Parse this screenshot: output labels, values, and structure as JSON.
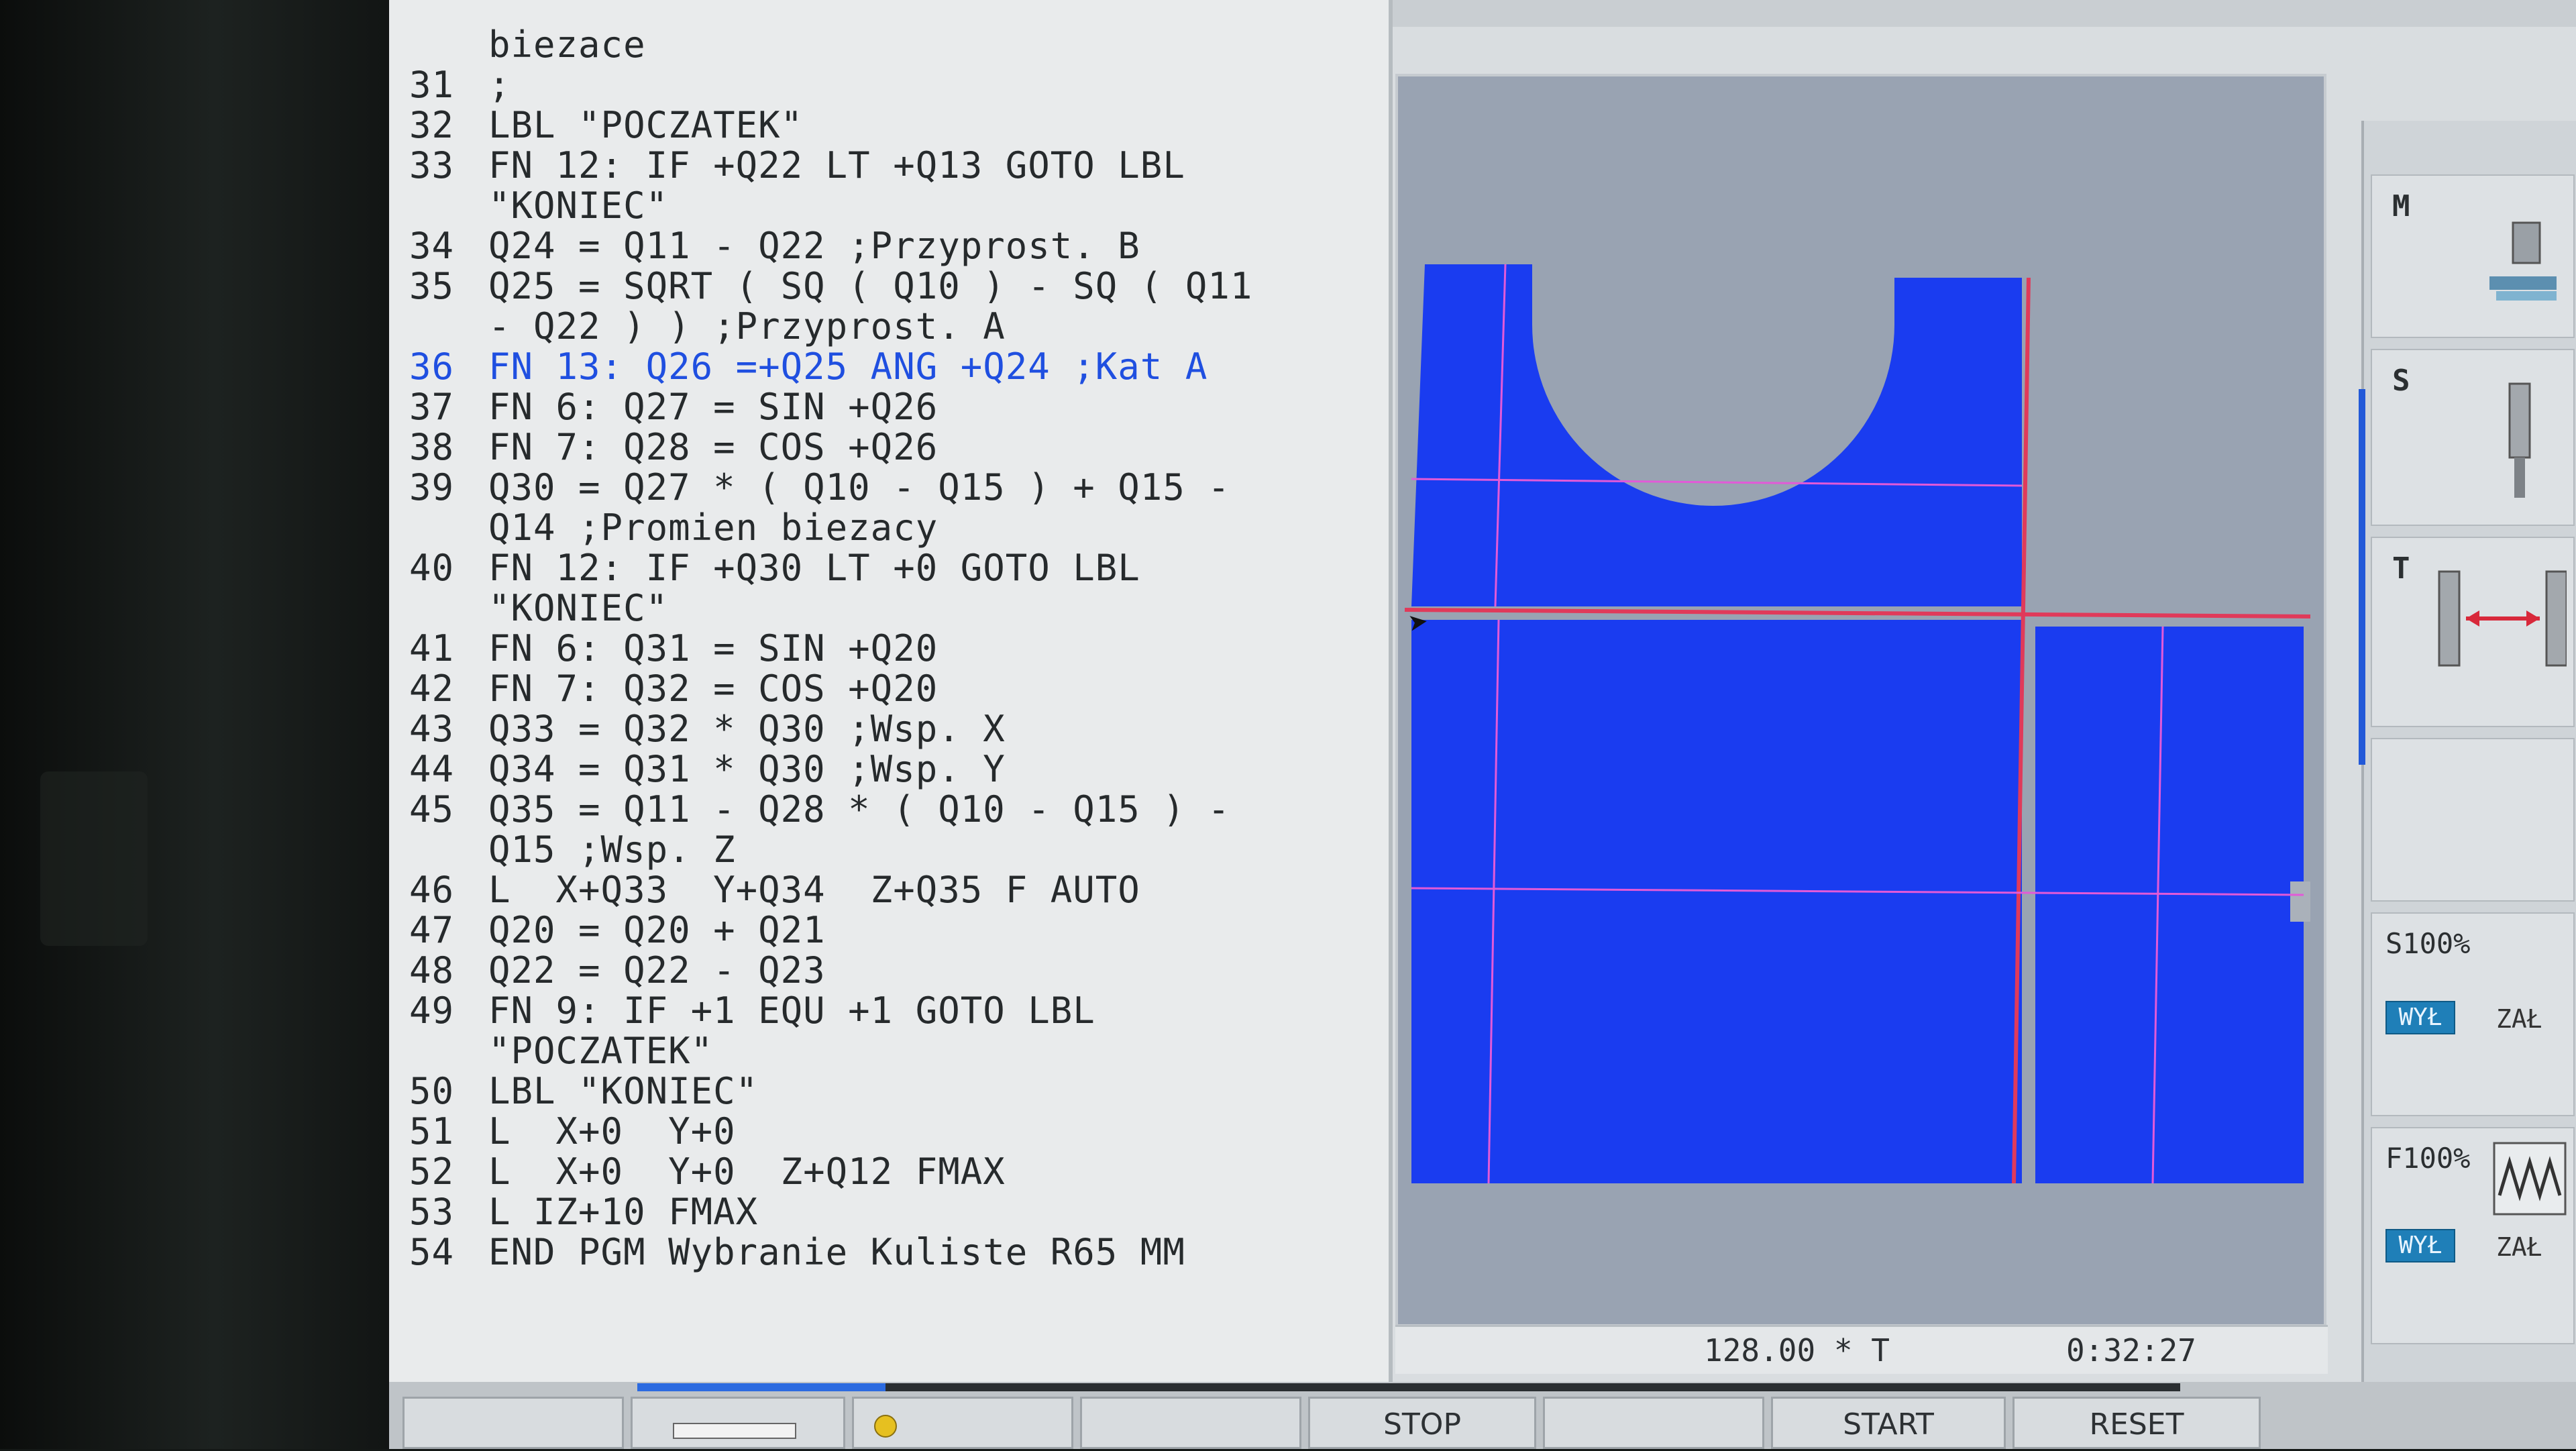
{
  "program": {
    "lines": [
      {
        "num": "",
        "text": "biezace"
      },
      {
        "num": "31",
        "text": ";"
      },
      {
        "num": "32",
        "text": "LBL \"POCZATEK\""
      },
      {
        "num": "33",
        "text": "FN 12: IF +Q22 LT +Q13 GOTO LBL"
      },
      {
        "num": "",
        "text": "\"KONIEC\""
      },
      {
        "num": "34",
        "text": "Q24 = Q11 - Q22 ;Przyprost. B"
      },
      {
        "num": "35",
        "text": "Q25 = SQRT ( SQ ( Q10 ) - SQ ( Q11"
      },
      {
        "num": "",
        "text": "- Q22 ) ) ;Przyprost. A"
      },
      {
        "num": "36",
        "text": "FN 13: Q26 =+Q25 ANG +Q24 ;Kat A"
      },
      {
        "num": "37",
        "text": "FN 6: Q27 = SIN +Q26"
      },
      {
        "num": "38",
        "text": "FN 7: Q28 = COS +Q26"
      },
      {
        "num": "39",
        "text": "Q30 = Q27 * ( Q10 - Q15 ) + Q15 -"
      },
      {
        "num": "",
        "text": "Q14 ;Promien biezacy"
      },
      {
        "num": "40",
        "text": "FN 12: IF +Q30 LT +0 GOTO LBL"
      },
      {
        "num": "",
        "text": "\"KONIEC\""
      },
      {
        "num": "41",
        "text": "FN 6: Q31 = SIN +Q20"
      },
      {
        "num": "42",
        "text": "FN 7: Q32 = COS +Q20"
      },
      {
        "num": "43",
        "text": "Q33 = Q32 * Q30 ;Wsp. X"
      },
      {
        "num": "44",
        "text": "Q34 = Q31 * Q30 ;Wsp. Y"
      },
      {
        "num": "45",
        "text": "Q35 = Q11 - Q28 * ( Q10 - Q15 ) -"
      },
      {
        "num": "",
        "text": "Q15 ;Wsp. Z"
      },
      {
        "num": "46",
        "text": "L  X+Q33  Y+Q34  Z+Q35 F AUTO"
      },
      {
        "num": "47",
        "text": "Q20 = Q20 + Q21"
      },
      {
        "num": "48",
        "text": "Q22 = Q22 - Q23"
      },
      {
        "num": "49",
        "text": "FN 9: IF +1 EQU +1 GOTO LBL"
      },
      {
        "num": "",
        "text": "\"POCZATEK\""
      },
      {
        "num": "50",
        "text": "LBL \"KONIEC\""
      },
      {
        "num": "51",
        "text": "L  X+0  Y+0"
      },
      {
        "num": "52",
        "text": "L  X+0  Y+0  Z+Q12 FMAX"
      },
      {
        "num": "53",
        "text": "L IZ+10 FMAX"
      },
      {
        "num": "54",
        "text": "END PGM Wybranie Kuliste R65 MM"
      }
    ],
    "active_line": "36"
  },
  "status": {
    "position": "128.00 * T",
    "time": "0:32:27"
  },
  "side": {
    "m_label": "M",
    "s_label": "S",
    "t_label": "T",
    "spindle_override": "S100%",
    "feed_override": "F100%",
    "off_label": "WYŁ",
    "on_label": "ZAŁ"
  },
  "softkeys": {
    "stop": "STOP",
    "start": "START",
    "reset": "RESET"
  },
  "colors": {
    "workpiece": "#1a3cf0",
    "section_line": "#e03a5a",
    "active_code": "#1f4fe0"
  }
}
